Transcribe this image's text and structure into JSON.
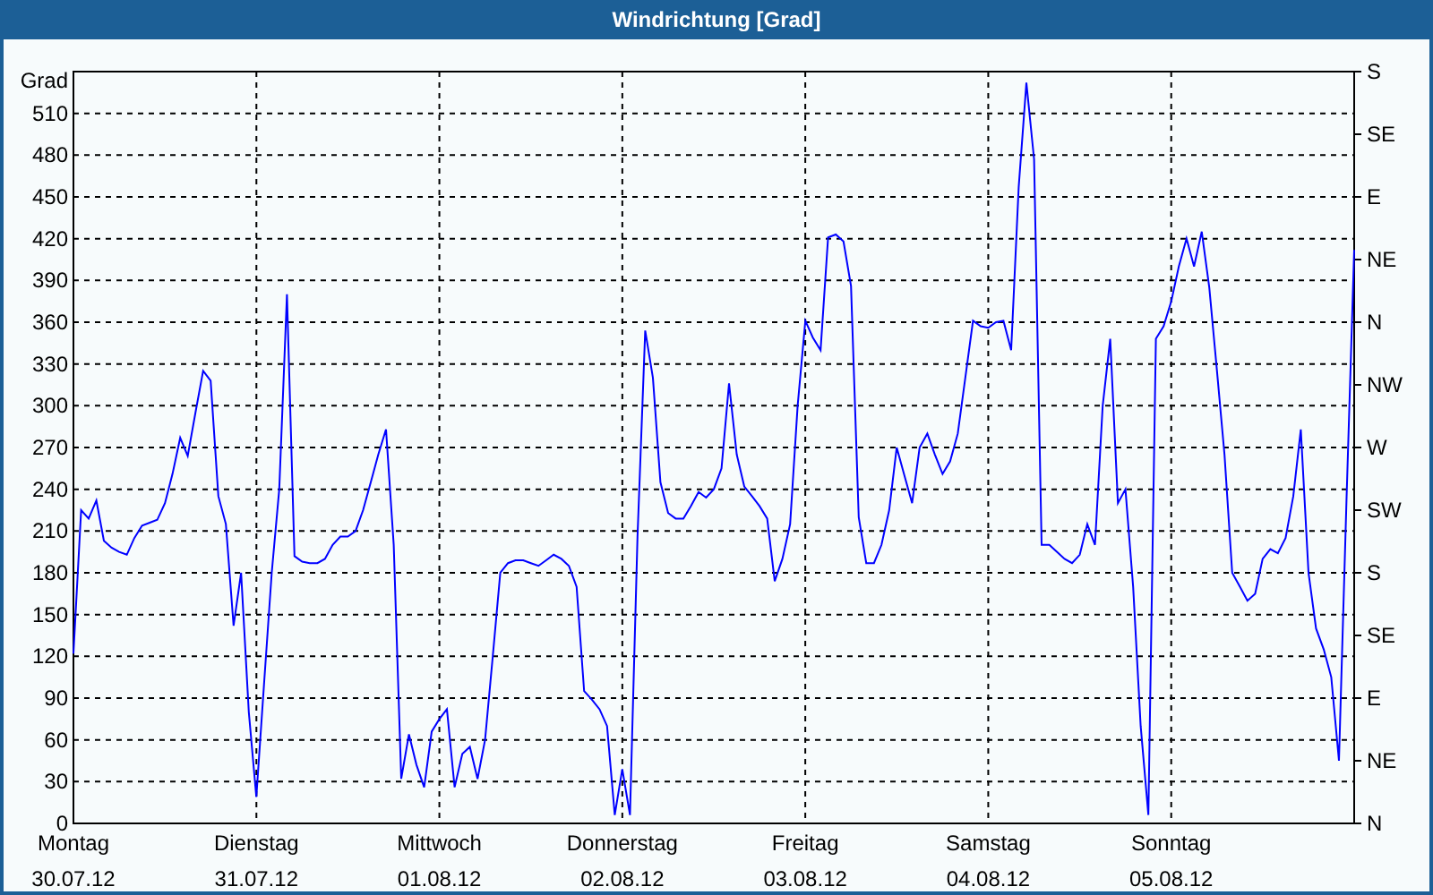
{
  "chart": {
    "chart_data": {
      "type": "line",
      "grid": true,
      "title": "Windrichtung [Grad]",
      "ylabel": "Grad",
      "ylim": [
        0,
        540
      ],
      "yticks": [
        0,
        30,
        60,
        90,
        120,
        150,
        180,
        210,
        240,
        270,
        300,
        330,
        360,
        390,
        420,
        450,
        480,
        510
      ],
      "categories": [
        "Montag",
        null,
        null,
        null,
        null,
        null,
        null,
        null,
        null,
        null,
        null,
        null,
        null,
        null,
        null,
        null,
        null,
        null,
        null,
        null,
        null,
        null,
        null,
        null,
        "Dienstag",
        null,
        null,
        null,
        null,
        null,
        null,
        null,
        null,
        null,
        null,
        null,
        null,
        null,
        null,
        null,
        null,
        null,
        null,
        null,
        null,
        null,
        null,
        null,
        "Mittwoch",
        null,
        null,
        null,
        null,
        null,
        null,
        null,
        null,
        null,
        null,
        null,
        null,
        null,
        null,
        null,
        null,
        null,
        null,
        null,
        null,
        null,
        null,
        null,
        "Donnerstag",
        null,
        null,
        null,
        null,
        null,
        null,
        null,
        null,
        null,
        null,
        null,
        null,
        null,
        null,
        null,
        null,
        null,
        null,
        null,
        null,
        null,
        null,
        null,
        "Freitag",
        null,
        null,
        null,
        null,
        null,
        null,
        null,
        null,
        null,
        null,
        null,
        null,
        null,
        null,
        null,
        null,
        null,
        null,
        null,
        null,
        null,
        null,
        null,
        "Samstag",
        null,
        null,
        null,
        null,
        null,
        null,
        null,
        null,
        null,
        null,
        null,
        null,
        null,
        null,
        null,
        null,
        null,
        null,
        null,
        null,
        null,
        null,
        null,
        "Sonntag",
        null,
        null,
        null,
        null,
        null,
        null,
        null,
        null,
        null,
        null,
        null,
        null,
        null,
        null,
        null,
        null,
        null,
        null,
        null,
        null,
        null,
        null,
        null,
        null
      ],
      "series": [
        {
          "color": "#0000ff",
          "values": [
            122,
            225,
            219,
            232,
            203,
            198,
            195,
            193,
            205,
            214,
            216,
            218,
            230,
            251,
            277,
            264,
            295,
            325,
            318,
            235,
            215,
            142,
            180,
            80,
            19,
            100,
            180,
            240,
            380,
            192,
            188,
            187,
            187,
            190,
            200,
            206,
            206,
            210,
            225,
            245,
            265,
            283,
            200,
            32,
            64,
            42,
            26,
            66,
            75,
            82,
            26,
            50,
            55,
            32,
            60,
            120,
            180,
            187,
            189,
            189,
            187,
            185,
            189,
            193,
            190,
            185,
            170,
            95,
            89,
            82,
            70,
            6,
            39,
            6,
            206,
            354,
            320,
            245,
            223,
            219,
            219,
            228,
            238,
            234,
            240,
            255,
            316,
            265,
            242,
            235,
            228,
            219,
            174,
            190,
            215,
            300,
            361,
            349,
            340,
            421,
            423,
            418,
            386,
            220,
            187,
            187,
            200,
            225,
            270,
            250,
            230,
            270,
            280,
            265,
            251,
            260,
            280,
            320,
            361,
            357,
            356,
            360,
            361,
            340,
            457,
            532,
            477,
            200,
            200,
            195,
            190,
            187,
            193,
            215,
            200,
            300,
            348,
            230,
            240,
            170,
            70,
            6,
            348,
            357,
            375,
            400,
            420,
            400,
            425,
            385,
            325,
            265,
            180,
            170,
            160,
            165,
            190,
            197,
            194,
            205,
            235,
            283,
            180,
            140,
            125,
            105,
            45,
            232,
            412
          ]
        }
      ]
    },
    "right_axis_labels": [
      "S",
      "SE",
      "E",
      "NE",
      "N",
      "NW",
      "W",
      "SW",
      "S",
      "SE",
      "E",
      "NE",
      "N"
    ],
    "dates": [
      "30.07.12",
      "31.07.12",
      "01.08.12",
      "02.08.12",
      "03.08.12",
      "04.08.12",
      "05.08.12"
    ]
  }
}
